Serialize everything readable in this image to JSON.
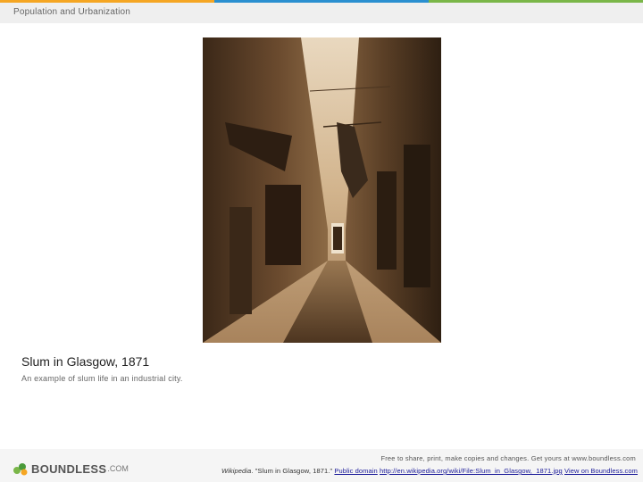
{
  "header": {
    "title": "Population and Urbanization",
    "accent_colors": [
      "#f5a623",
      "#2a8fd0",
      "#7ab648"
    ]
  },
  "photo": {
    "alt": "Slum in Glasgow, 1871"
  },
  "caption": {
    "title": "Slum in Glasgow, 1871",
    "subtitle": "An example of slum life in an industrial city."
  },
  "footer": {
    "logo_main": "BOUNDLESS",
    "logo_domain": ".COM",
    "share_text": "Free to share, print, make copies and changes. Get yours at www.boundless.com",
    "attribution": {
      "source": "Wikipedia",
      "title": ". \"Slum in Glasgow, 1871.\" ",
      "license": "Public domain",
      "url": "http://en.wikipedia.org/wiki/File:Slum_in_Glasgow,_1871.jpg",
      "view_link": "View on Boundless.com"
    }
  }
}
